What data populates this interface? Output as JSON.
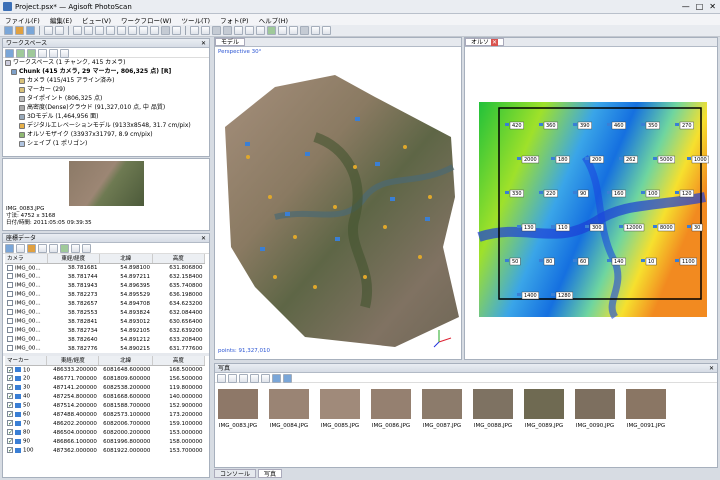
{
  "window": {
    "title": "Project.psx* — Agisoft PhotoScan",
    "minimize": "—",
    "maximize": "□",
    "close": "✕"
  },
  "menu": [
    "ファイル(F)",
    "編集(E)",
    "ビュー(V)",
    "ワークフロー(W)",
    "ツール(T)",
    "フォト(P)",
    "ヘルプ(H)"
  ],
  "workspace": {
    "header": "ワークスペース",
    "items": [
      "ワークスペース (1 チャンク, 415 カメラ)",
      "Chunk (415 カメラ, 29 マーカー, 806,325 点) [R]",
      "カメラ (415/415 アライン済み)",
      "マーカー (29)",
      "タイポイント (806,325 点)",
      "高密度(Dense)クラウド (91,327,010 点, 中 品質)",
      "3Dモデル (1,464,956 面)",
      "デジタルエレベーションモデル (9133x8548, 31.7 cm/pix)",
      "オルソモザイク (33937x31797, 8.9 cm/pix)",
      "シェイプ (1 ポリゴン)"
    ]
  },
  "photo_preview": {
    "filename": "IMG_0083.JPG",
    "size": "寸法: 4752 x 3168",
    "date": "日付/時間: 2011:05:05 09:39:35"
  },
  "reference": {
    "header": "座標データ",
    "cam_headers": [
      "カメラ",
      "東経/経度",
      "北緯",
      "高度"
    ],
    "cameras": [
      [
        "IMG_00...",
        "38.781681",
        "54.898100",
        "631.806800"
      ],
      [
        "IMG_00...",
        "38.781744",
        "54.897211",
        "632.158400"
      ],
      [
        "IMG_00...",
        "38.781943",
        "54.896395",
        "635.740800"
      ],
      [
        "IMG_00...",
        "38.782273",
        "54.895529",
        "636.198000"
      ],
      [
        "IMG_00...",
        "38.782657",
        "54.894708",
        "634.623200"
      ],
      [
        "IMG_00...",
        "38.782553",
        "54.893824",
        "632.084400"
      ],
      [
        "IMG_00...",
        "38.782841",
        "54.893012",
        "630.656400"
      ],
      [
        "IMG_00...",
        "38.782734",
        "54.892105",
        "632.639200"
      ],
      [
        "IMG_00...",
        "38.782640",
        "54.891212",
        "633.208400"
      ],
      [
        "IMG_00...",
        "38.782776",
        "54.890215",
        "631.777600"
      ]
    ],
    "marker_headers": [
      "マーカー",
      "東経/経度",
      "北緯",
      "高度"
    ],
    "markers": [
      [
        "10",
        "486333.200000",
        "6081648.600000",
        "168.500000"
      ],
      [
        "20",
        "486771.700000",
        "6081809.600000",
        "156.500000"
      ],
      [
        "30",
        "487141.200000",
        "6082538.200000",
        "119.800000"
      ],
      [
        "40",
        "487254.800000",
        "6081668.600000",
        "140.000000"
      ],
      [
        "50",
        "487514.200000",
        "6081588.700000",
        "152.900000"
      ],
      [
        "60",
        "487488.400000",
        "6082573.100000",
        "173.200000"
      ],
      [
        "70",
        "486202.200000",
        "6082006.700000",
        "159.100000"
      ],
      [
        "80",
        "486504.000000",
        "6082000.200000",
        "153.000000"
      ],
      [
        "90",
        "486866.100000",
        "6081996.800000",
        "158.000000"
      ],
      [
        "100",
        "487362.000000",
        "6081922.000000",
        "153.700000"
      ]
    ]
  },
  "model_view": {
    "tab": "モデル",
    "perspective": "Perspective 30°",
    "points": "points: 91,327,010"
  },
  "ortho_view": {
    "tab": "オルソ"
  },
  "ortho_labels": [
    "420",
    "360",
    "390",
    "460",
    "350",
    "270",
    "2000",
    "180",
    "200",
    "262",
    "5000",
    "1000",
    "330",
    "220",
    "90",
    "160",
    "100",
    "120",
    "130",
    "110",
    "300",
    "12000",
    "8000",
    "30",
    "50",
    "80",
    "60",
    "140",
    "10",
    "1100",
    "1400",
    "1280"
  ],
  "photos": {
    "header": "写真",
    "items": [
      "IMG_0083.JPG",
      "IMG_0084.JPG",
      "IMG_0085.JPG",
      "IMG_0086.JPG",
      "IMG_0087.JPG",
      "IMG_0088.JPG",
      "IMG_0089.JPG",
      "IMG_0090.JPG",
      "IMG_0091.JPG"
    ],
    "tabs": [
      "コンソール",
      "写真"
    ]
  }
}
